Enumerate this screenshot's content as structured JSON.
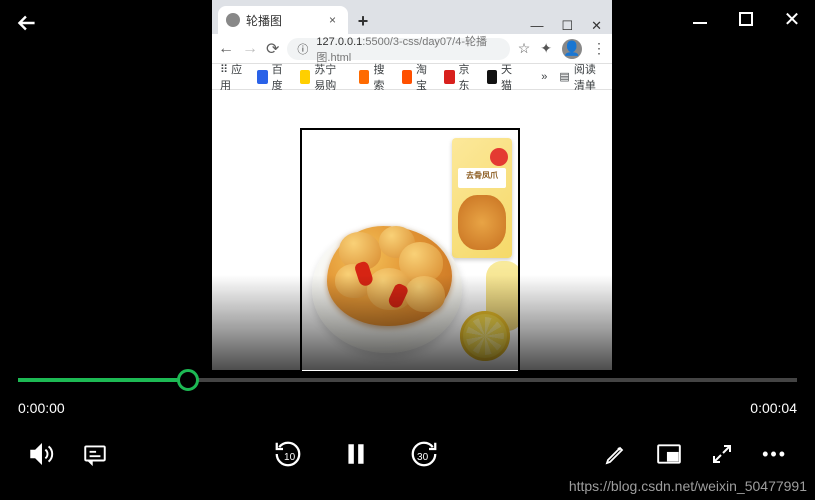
{
  "browser": {
    "tab_title": "轮播图",
    "url_host": "127.0.0.1",
    "url_port_path": ":5500/3-css/day07/4-轮播图.html",
    "bookmarks": {
      "apps": "应用",
      "baidu": "百度",
      "suning": "苏宁易购",
      "sougou": "搜索",
      "taobao": "淘宝",
      "jd": "京东",
      "tmall": "天猫",
      "reading_list": "阅读清单"
    },
    "product_label": "去骨凤爪"
  },
  "player": {
    "time_current": "0:00:00",
    "time_total": "0:00:04",
    "rewind_seconds": "10",
    "forward_seconds": "30"
  },
  "watermark": "https://blog.csdn.net/weixin_50477991"
}
